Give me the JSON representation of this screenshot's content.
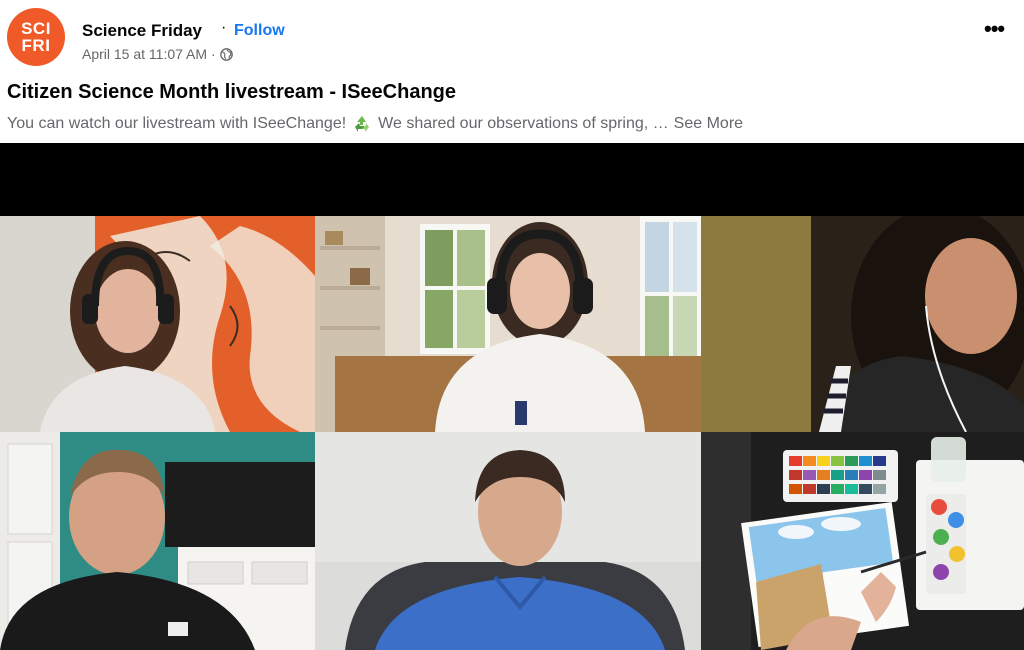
{
  "post": {
    "page_name": "Science Friday",
    "dot": "·",
    "follow_label": "Follow",
    "timestamp": "April 15 at 11:07 AM",
    "meta_dot": "·",
    "more_label": "•••",
    "title": "Citizen Science Month livestream - ISeeChange",
    "text_before": "You can watch our livestream with ISeeChange!",
    "text_after": "We shared our observations of spring, …",
    "see_more_label": "See More"
  },
  "avatar": {
    "line1": "SCI",
    "line2": "FRI"
  },
  "icons": {
    "globe": "globe-icon",
    "recycle": "recycle-icon",
    "more": "more-options-icon"
  },
  "colors": {
    "brand": "#f05a28",
    "link": "#1877f2",
    "secondary_text": "#65676b"
  }
}
